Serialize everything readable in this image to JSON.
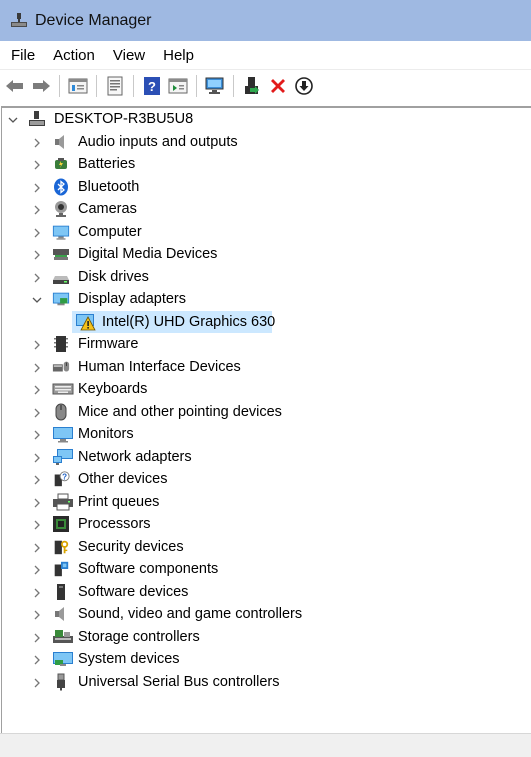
{
  "window": {
    "title": "Device Manager"
  },
  "menu": [
    "File",
    "Action",
    "View",
    "Help"
  ],
  "toolbar": {
    "buttons": [
      "back-icon",
      "forward-icon",
      "properties-icon",
      "update-icon",
      "help-icon",
      "action-icon",
      "scan-icon",
      "enable-icon",
      "uninstall-icon",
      "download-icon"
    ]
  },
  "tree": {
    "root": "DESKTOP-R3BU5U8",
    "categories": [
      "Audio inputs and outputs",
      "Batteries",
      "Bluetooth",
      "Cameras",
      "Computer",
      "Digital Media Devices",
      "Disk drives",
      "Display adapters",
      "Firmware",
      "Human Interface Devices",
      "Keyboards",
      "Mice and other pointing devices",
      "Monitors",
      "Network adapters",
      "Other devices",
      "Print queues",
      "Processors",
      "Security devices",
      "Software components",
      "Software devices",
      "Sound, video and game controllers",
      "Storage controllers",
      "System devices",
      "Universal Serial Bus controllers"
    ],
    "expanded_child": "Intel(R) UHD Graphics 630"
  }
}
